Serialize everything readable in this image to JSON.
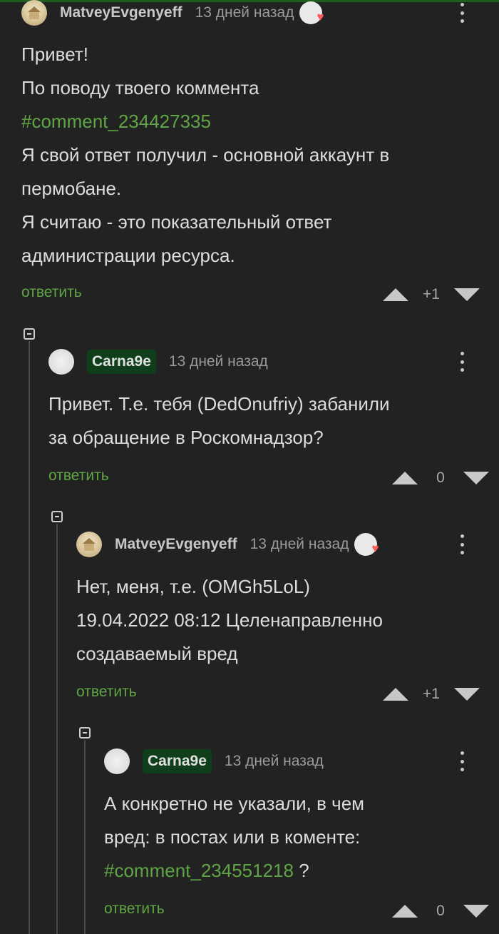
{
  "comments": [
    {
      "username": "MatveyEvgenyeff",
      "time": "13 дней назад",
      "body_lines": [
        "Привет!",
        "По поводу твоего коммента"
      ],
      "link": "#comment_234427335",
      "body_lines_after": [
        "Я свой ответ получил - основной аккаунт в",
        "пермобане.",
        "Я считаю - это показательный ответ",
        "администрации ресурса."
      ],
      "reply_label": "ответить",
      "score": "+1"
    },
    {
      "username": "Carna9e",
      "time": "13 дней назад",
      "body_lines": [
        "Привет. Т.е. тебя (DedOnufriy) забанили",
        "за обращение в Роскомнадзор?"
      ],
      "reply_label": "ответить",
      "score": "0"
    },
    {
      "username": "MatveyEvgenyeff",
      "time": "13 дней назад",
      "body_lines": [
        "Нет, меня, т.е. (OMGh5LoL)",
        "19.04.2022 08:12 Целенаправленно",
        "создаваемый вред"
      ],
      "reply_label": "ответить",
      "score": "+1"
    },
    {
      "username": "Carna9e",
      "time": "13 дней назад",
      "body_lines": [
        "А конкретно не указали, в чем",
        "вред: в постах или в коменте:"
      ],
      "link": "#comment_234551218",
      "link_suffix": " ?",
      "reply_label": "ответить",
      "score": "0"
    }
  ],
  "colors": {
    "background": "#222222",
    "link": "#5fa545",
    "op_badge": "#0f3f1a",
    "heart": "#ff5a5a"
  },
  "icons": [
    "avatar-house",
    "avatar-bird",
    "heart-badge-icon",
    "kebab-menu-icon",
    "upvote-icon",
    "downvote-icon",
    "collapse-icon"
  ]
}
